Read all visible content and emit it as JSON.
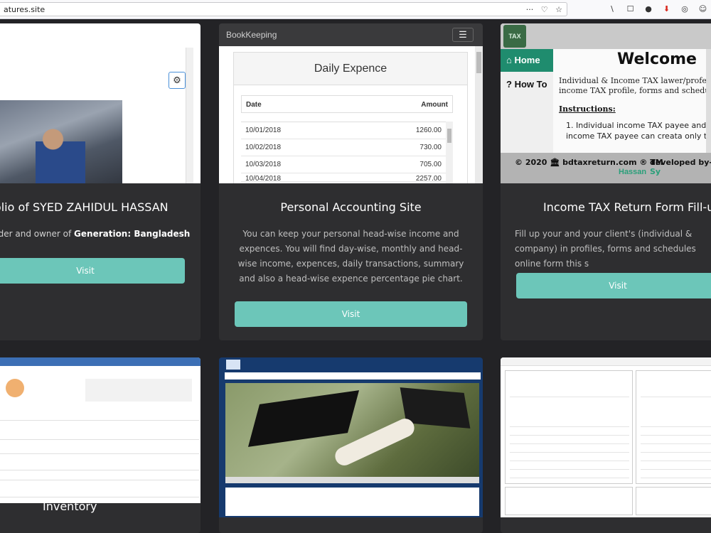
{
  "browser": {
    "url_text": "atures.site",
    "url_icons": [
      "···",
      "♡",
      "☆"
    ],
    "toolbar_icons": [
      "\\",
      "☐",
      "●",
      "⬇",
      "◎",
      "☺"
    ]
  },
  "cards": [
    {
      "title": "tfolio of SYED ZAHIDUL HASSAN",
      "desc_prefix": "nder and owner of ",
      "desc_bold": "Generation: Bangladesh",
      "button": "Visit"
    },
    {
      "brand": "BookKeeping",
      "menu_icon": "☰",
      "panel_title": "Daily Expence",
      "col_date": "Date",
      "col_amount": "Amount",
      "rows": [
        {
          "date": "10/01/2018",
          "amount": "1260.00"
        },
        {
          "date": "10/02/2018",
          "amount": "730.00"
        },
        {
          "date": "10/03/2018",
          "amount": "705.00"
        },
        {
          "date": "10/04/2018",
          "amount": "2257.00"
        }
      ],
      "title": "Personal Accounting Site",
      "description": "You can keep your personal head-wise income and expences. You will find day-wise, monthly and head-wise income, expences, daily transactions, summary and also a head-wise expence percentage pie chart.",
      "button": "Visit"
    },
    {
      "logo": "TAX",
      "nav_home": "Home",
      "nav_howto": "How To",
      "welcome": "Welcome",
      "intro": "Individual & Income TAX lawer/professionals income TAX profile, forms and schedules fro",
      "instructions": "Instructions:",
      "item1": "Individual income TAX payee and Com income TAX payee can creata only the profile.",
      "footer_copy": "© 2020 🏛 bdtaxreturn.com ® TM",
      "footer_dev_prefix": "developed by- ",
      "footer_dev_name": "Sy",
      "footer_hassan": "Hassan",
      "title": "Income TAX Return Form Fill-up Si",
      "description": "Fill up your and your client's (individual & company) in profiles, forms and schedules online form this s",
      "button": "Visit"
    }
  ],
  "bottom_cards": [
    {
      "title": "Inventory"
    },
    {
      "title": ""
    },
    {
      "title": ""
    }
  ]
}
